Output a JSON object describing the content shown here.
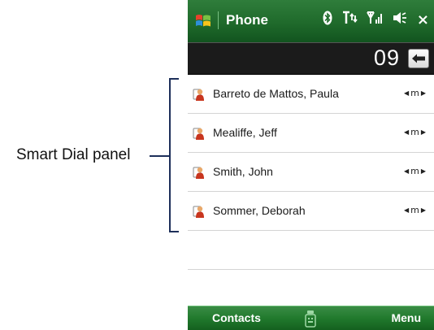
{
  "annotation": {
    "label": "Smart Dial panel"
  },
  "titlebar": {
    "title": "Phone",
    "start_icon": "windows-flag-icon",
    "status_icons": [
      "bluetooth-icon",
      "data-connection-icon",
      "signal-icon",
      "speaker-icon"
    ],
    "close_label": "×"
  },
  "dialer": {
    "digits": "09",
    "backspace_icon": "backspace-arrow-icon"
  },
  "contacts": [
    {
      "name": "Barreto de Mattos, Paula",
      "type": "m"
    },
    {
      "name": "Mealiffe, Jeff",
      "type": "m"
    },
    {
      "name": "Smith, John",
      "type": "m"
    },
    {
      "name": "Sommer, Deborah",
      "type": "m"
    }
  ],
  "softkeys": {
    "left": "Contacts",
    "right": "Menu",
    "center_icon": "keyboard-icon"
  },
  "colors": {
    "titlebar_green": "#1f6a2b",
    "softkey_green": "#217a2d",
    "dialbar_black": "#1b1b1b",
    "annotation_line": "#1d2f5a"
  }
}
